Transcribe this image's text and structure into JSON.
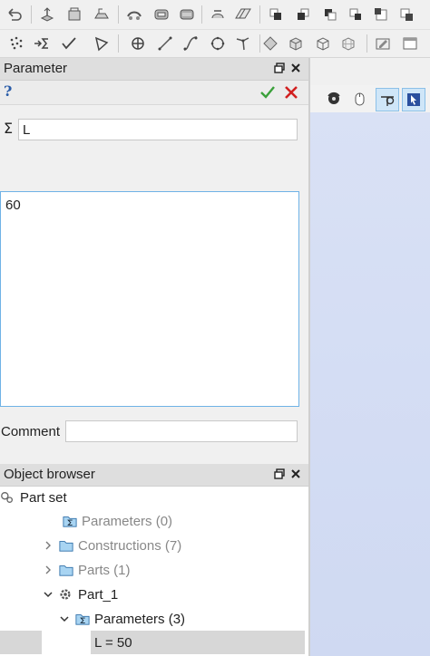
{
  "toolbar_top": {
    "icons": [
      "undo-icon",
      "extrude-icon",
      "revolve-icon",
      "sweep-icon",
      "fillet-icon",
      "boolean-icon",
      "shell-icon",
      "loft-icon",
      "surface-icon",
      "view-front-icon",
      "view-back-icon",
      "view-left-icon",
      "view-right-icon",
      "view-top-icon",
      "view-iso-icon"
    ]
  },
  "toolbar_sketch": {
    "icons": [
      "point-cloud-icon",
      "sum-arrow-icon",
      "check-line-icon",
      "polyline-icon",
      "point-icon",
      "line-icon",
      "spline-icon",
      "circle-icon",
      "angle-icon",
      "plane-icon",
      "box-icon",
      "wire-box-icon",
      "grid-box-icon",
      "sketch-icon",
      "panel-icon"
    ]
  },
  "parameter_panel": {
    "title": "Parameter",
    "help": "?",
    "name_value": "L",
    "sigma": "Σ",
    "expression_value": "60",
    "comment_label": "Comment",
    "comment_value": ""
  },
  "object_browser": {
    "title": "Object browser",
    "nodes": [
      {
        "label": "Part set"
      },
      {
        "label": "Parameters (0)"
      },
      {
        "label": "Constructions (7)"
      },
      {
        "label": "Parts (1)"
      },
      {
        "label": "Part_1"
      },
      {
        "label": "Parameters (3)"
      },
      {
        "label": "L = 50"
      }
    ]
  },
  "colors": {
    "accept": "#3aa03a",
    "reject": "#d22020",
    "selection": "#d7d7d7",
    "focus_border": "#6fb2e6"
  }
}
